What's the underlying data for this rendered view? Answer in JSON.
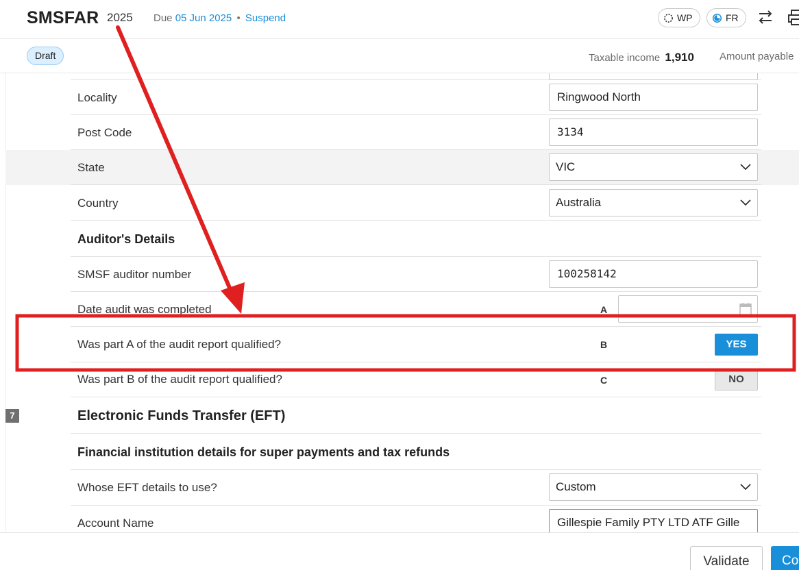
{
  "header": {
    "app_title": "SMSFAR",
    "year": "2025",
    "due_label": "Due",
    "due_date": "05 Jun 2025",
    "separator": "•",
    "suspend_link": "Suspend",
    "wp_pill": "WP",
    "fr_pill": "FR"
  },
  "subbar": {
    "status_badge": "Draft",
    "taxable_income_label": "Taxable income",
    "taxable_income_value": "1,910",
    "amount_payable_label": "Amount payable"
  },
  "form": {
    "locality": {
      "label": "Locality",
      "value": "Ringwood North"
    },
    "post_code": {
      "label": "Post Code",
      "value": "3134"
    },
    "state": {
      "label": "State",
      "value": "VIC"
    },
    "country": {
      "label": "Country",
      "value": "Australia"
    },
    "auditor_heading": "Auditor's Details",
    "auditor_number": {
      "label": "SMSF auditor number",
      "value": "100258142"
    },
    "audit_date": {
      "label": "Date audit was completed",
      "code": "A",
      "value": ""
    },
    "part_a": {
      "label": "Was part A of the audit report qualified?",
      "code": "B",
      "value": "YES"
    },
    "part_b": {
      "label": "Was part B of the audit report qualified?",
      "code": "C",
      "value": "NO"
    },
    "eft_section_number": "7",
    "eft_heading": "Electronic Funds Transfer (EFT)",
    "fin_heading": "Financial institution details for super payments and tax refunds",
    "eft_details": {
      "label": "Whose EFT details to use?",
      "value": "Custom"
    },
    "account_name": {
      "label": "Account Name",
      "value": "Gillespie Family PTY LTD ATF Gille"
    }
  },
  "footer": {
    "validate_label": "Validate",
    "continue_label": "Co"
  },
  "colors": {
    "accent": "#1a8fd9",
    "annotation": "#e02020",
    "draft_bg": "#dcefff"
  }
}
